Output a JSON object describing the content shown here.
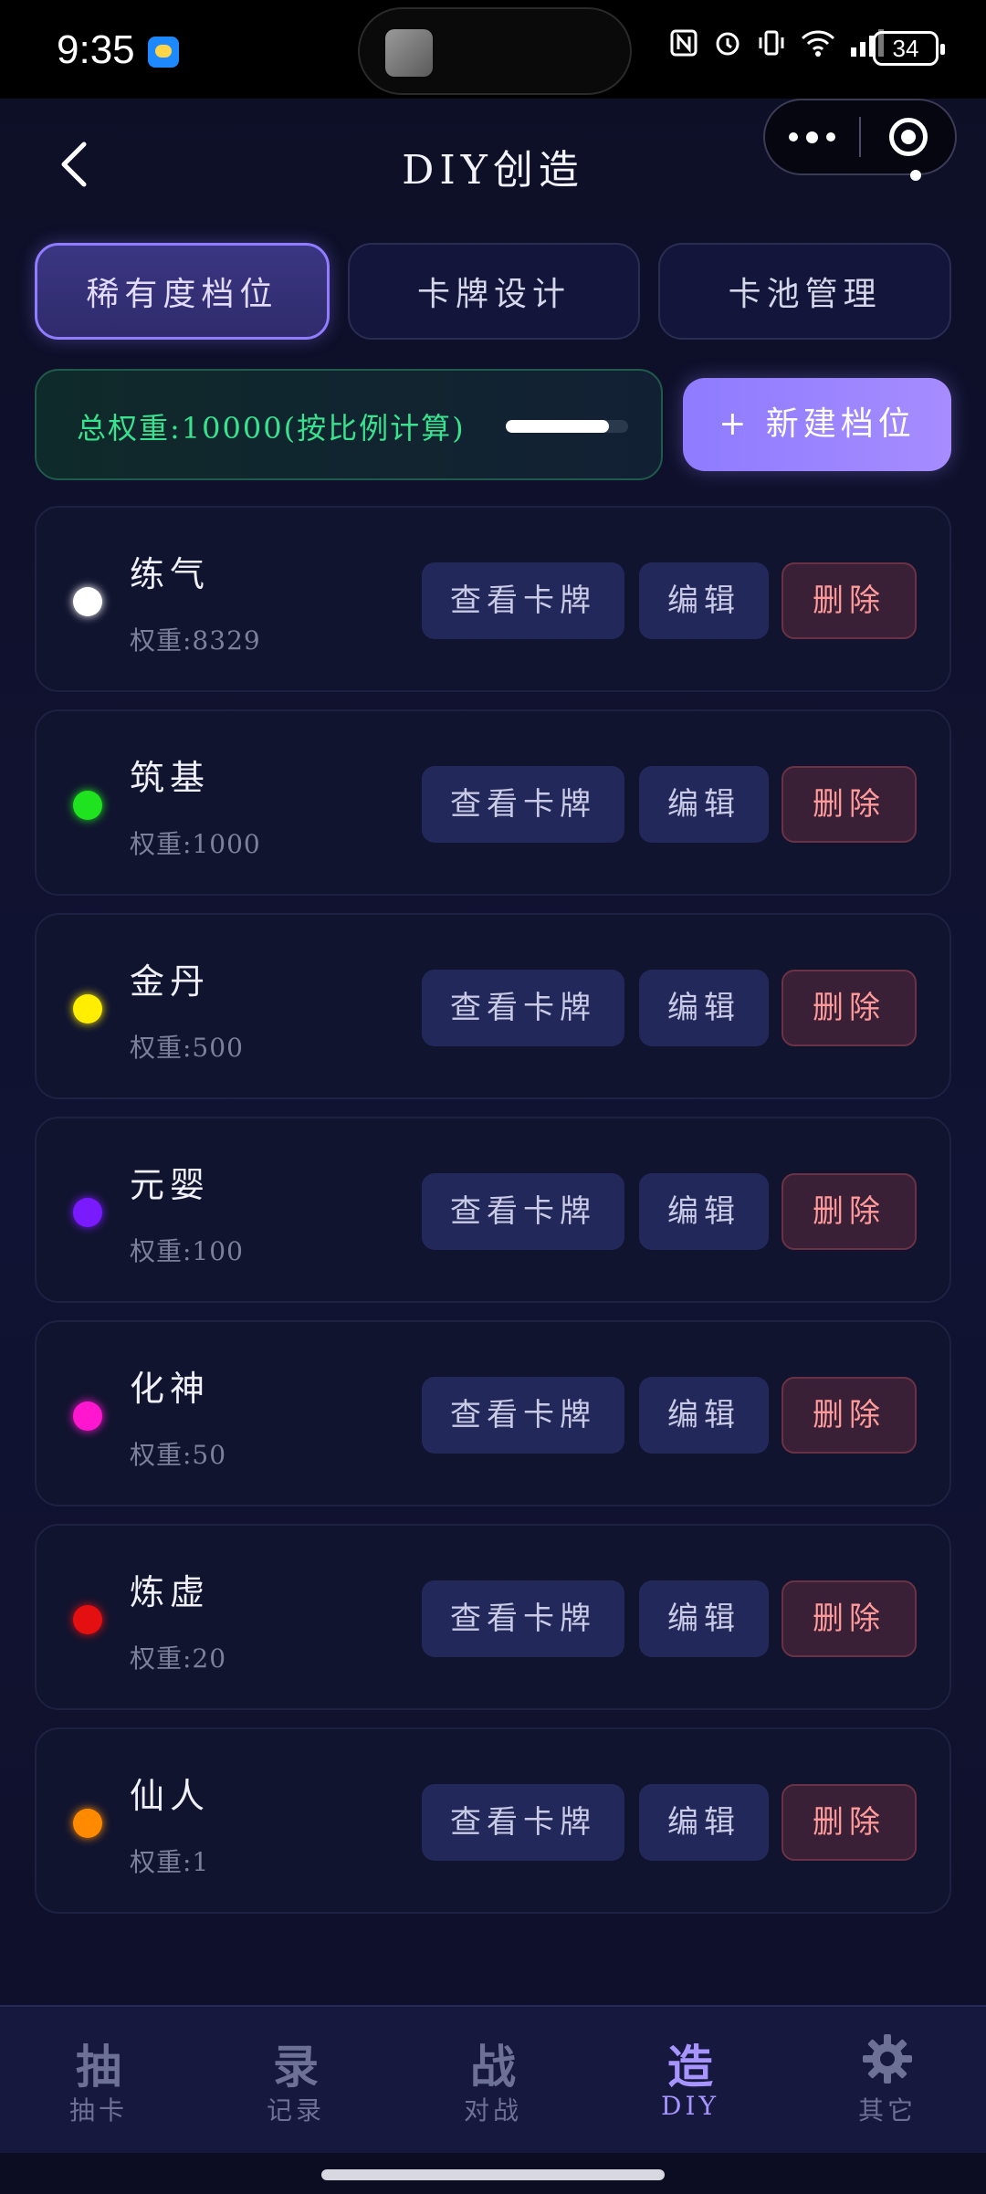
{
  "status_bar": {
    "time": "9:35",
    "battery": "34",
    "icons": [
      "nfc-icon",
      "alarm-icon",
      "vibrate-icon",
      "wifi-icon",
      "signal-icon"
    ]
  },
  "header": {
    "title": "DIY创造",
    "back_icon": "chevron-left-icon"
  },
  "tabs": [
    {
      "label": "稀有度档位",
      "active": true
    },
    {
      "label": "卡牌设计",
      "active": false
    },
    {
      "label": "卡池管理",
      "active": false
    }
  ],
  "summary": {
    "total_weight_text": "总权重:10000(按比例计算)",
    "progress_fraction": 0.84,
    "new_button": "+ 新建档位"
  },
  "tier_buttons": {
    "view": "查看卡牌",
    "edit": "编辑",
    "delete": "删除"
  },
  "tiers": [
    {
      "name": "练气",
      "weight": "权重:8329",
      "color": "#ffffff"
    },
    {
      "name": "筑基",
      "weight": "权重:1000",
      "color": "#1fe31f"
    },
    {
      "name": "金丹",
      "weight": "权重:500",
      "color": "#ffee00"
    },
    {
      "name": "元婴",
      "weight": "权重:100",
      "color": "#7a1bff"
    },
    {
      "name": "化神",
      "weight": "权重:50",
      "color": "#ff17d0"
    },
    {
      "name": "炼虚",
      "weight": "权重:20",
      "color": "#e30f10"
    },
    {
      "name": "仙人",
      "weight": "权重:1",
      "color": "#ff8a00"
    }
  ],
  "bottom_nav": [
    {
      "glyph": "抽",
      "label": "抽卡",
      "active": false
    },
    {
      "glyph": "录",
      "label": "记录",
      "active": false
    },
    {
      "glyph": "战",
      "label": "对战",
      "active": false
    },
    {
      "glyph": "造",
      "label": "DIY",
      "active": true
    },
    {
      "glyph": "",
      "label": "其它",
      "active": false,
      "icon": "gear-icon"
    }
  ],
  "colors": {
    "accent": "#8f7cff",
    "weight_text": "#39e28e",
    "delete_text": "#ff9a9a"
  }
}
